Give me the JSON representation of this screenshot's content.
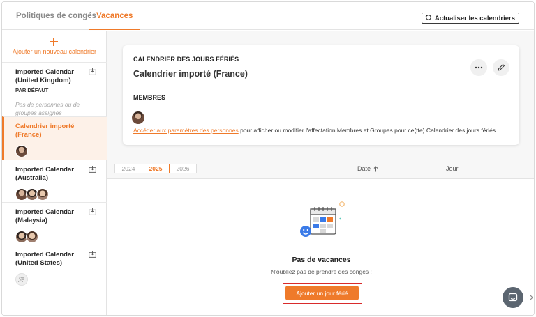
{
  "tabs": [
    {
      "label": "Politiques de congés",
      "active": false
    },
    {
      "label": "Vacances",
      "active": true
    }
  ],
  "toolbar": {
    "refresh_label": "Actualiser les calendriers",
    "refresh_icon": "refresh-icon"
  },
  "sidebar": {
    "add_label": "Ajouter un nouveau calendrier",
    "items": [
      {
        "name": "Imported Calendar (United Kingdom)",
        "tag": "PAR DÉFAUT",
        "empty_text": "Pas de personnes ou de groupes assignés"
      },
      {
        "name": "Calendrier importé (France)",
        "active": true
      },
      {
        "name": "Imported Calendar (Australia)"
      },
      {
        "name": "Imported Calendar (Malaysia)"
      },
      {
        "name": "Imported Calendar (United States)"
      }
    ]
  },
  "card": {
    "section_label": "CALENDRIER DES JOURS FÉRIÉS",
    "title": "Calendrier importé (France)",
    "members_label": "MEMBRES",
    "link_text": "Accéder aux paramètres des personnes",
    "note_text": " pour afficher ou modifier l'affectation Membres et Groupes pour ce(tte) Calendrier des jours fériés."
  },
  "years": [
    "2024",
    "2025",
    "2026"
  ],
  "selected_year": "2025",
  "table": {
    "col_date": "Date",
    "col_day": "Jour",
    "sort_icon": "arrow-up-icon"
  },
  "empty": {
    "title": "Pas de vacances",
    "subtitle": "N'oubliez pas de prendre des congés !",
    "button_label": "Ajouter un jour férié"
  },
  "colors": {
    "accent": "#ef7a2a",
    "highlight_box": "#d92b2b",
    "chat_bubble": "#5b6570"
  }
}
